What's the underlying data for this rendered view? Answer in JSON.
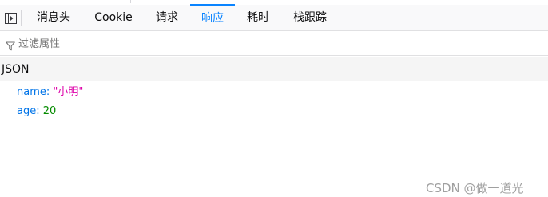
{
  "tabs": [
    {
      "label": "消息头",
      "active": false
    },
    {
      "label": "Cookie",
      "active": false
    },
    {
      "label": "请求",
      "active": false
    },
    {
      "label": "响应",
      "active": true
    },
    {
      "label": "耗时",
      "active": false
    },
    {
      "label": "栈跟踪",
      "active": false
    }
  ],
  "filter": {
    "placeholder": "过滤属性",
    "value": ""
  },
  "section": {
    "title": "JSON"
  },
  "json": [
    {
      "key": "name",
      "value": "\"小明\"",
      "type": "string"
    },
    {
      "key": "age",
      "value": "20",
      "type": "number"
    }
  ],
  "watermark": "CSDN @做一道光",
  "colors": {
    "accent": "#0a84ff",
    "key": "#0074e8",
    "string": "#dd00a9",
    "number": "#058b00"
  },
  "icons": {
    "panel_toggle": "sidebar-toggle-icon",
    "filter": "funnel-icon"
  }
}
